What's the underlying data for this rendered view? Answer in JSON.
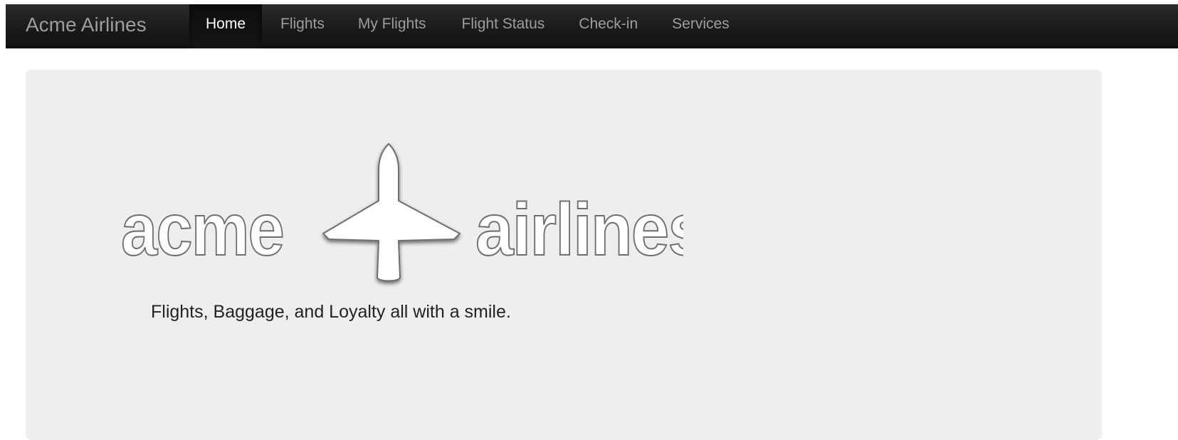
{
  "navbar": {
    "brand": "Acme Airlines",
    "items": [
      {
        "label": "Home",
        "active": true
      },
      {
        "label": "Flights",
        "active": false
      },
      {
        "label": "My Flights",
        "active": false
      },
      {
        "label": "Flight Status",
        "active": false
      },
      {
        "label": "Check-in",
        "active": false
      },
      {
        "label": "Services",
        "active": false
      }
    ]
  },
  "hero": {
    "logo_word_left": "acme",
    "logo_word_right": "airlines",
    "logo_icon": "airplane-icon",
    "tagline": "Flights, Baggage, and Loyalty all with a smile."
  },
  "colors": {
    "navbar_bg": "#1b1b1b",
    "nav_text": "#9d9d9d",
    "nav_active_text": "#ffffff",
    "hero_bg": "#eeeeee"
  }
}
